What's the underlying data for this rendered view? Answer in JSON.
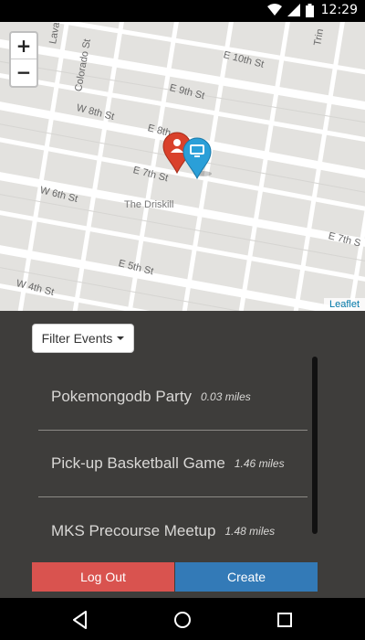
{
  "status_bar": {
    "time": "12:29"
  },
  "map": {
    "zoom_in": "+",
    "zoom_out": "−",
    "attribution": "Leaflet",
    "streets": [
      "E 10th St",
      "E 9th St",
      "W 8th St",
      "E 8th",
      "E 7th St",
      "W 6th St",
      "The Driskill",
      "E 5th St",
      "W 4th St",
      "E 7th S",
      "Colorado St",
      "Lava",
      "Trin"
    ],
    "markers": [
      {
        "type": "user-marker",
        "color": "#d9412b"
      },
      {
        "type": "event-marker",
        "color": "#2a9fd8"
      }
    ]
  },
  "panel": {
    "filter_label": "Filter Events",
    "events": [
      {
        "name": "Pokemongodb Party",
        "distance": "0.03 miles"
      },
      {
        "name": "Pick-up Basketball Game",
        "distance": "1.46 miles"
      },
      {
        "name": "MKS Precourse Meetup",
        "distance": "1.48 miles"
      }
    ],
    "logout_label": "Log Out",
    "create_label": "Create"
  },
  "colors": {
    "logout": "#d9534f",
    "create": "#337ab7",
    "panel_bg": "#3e3d3b"
  },
  "nav_bar": {
    "icons": [
      "back-icon",
      "home-icon",
      "recents-icon"
    ]
  }
}
